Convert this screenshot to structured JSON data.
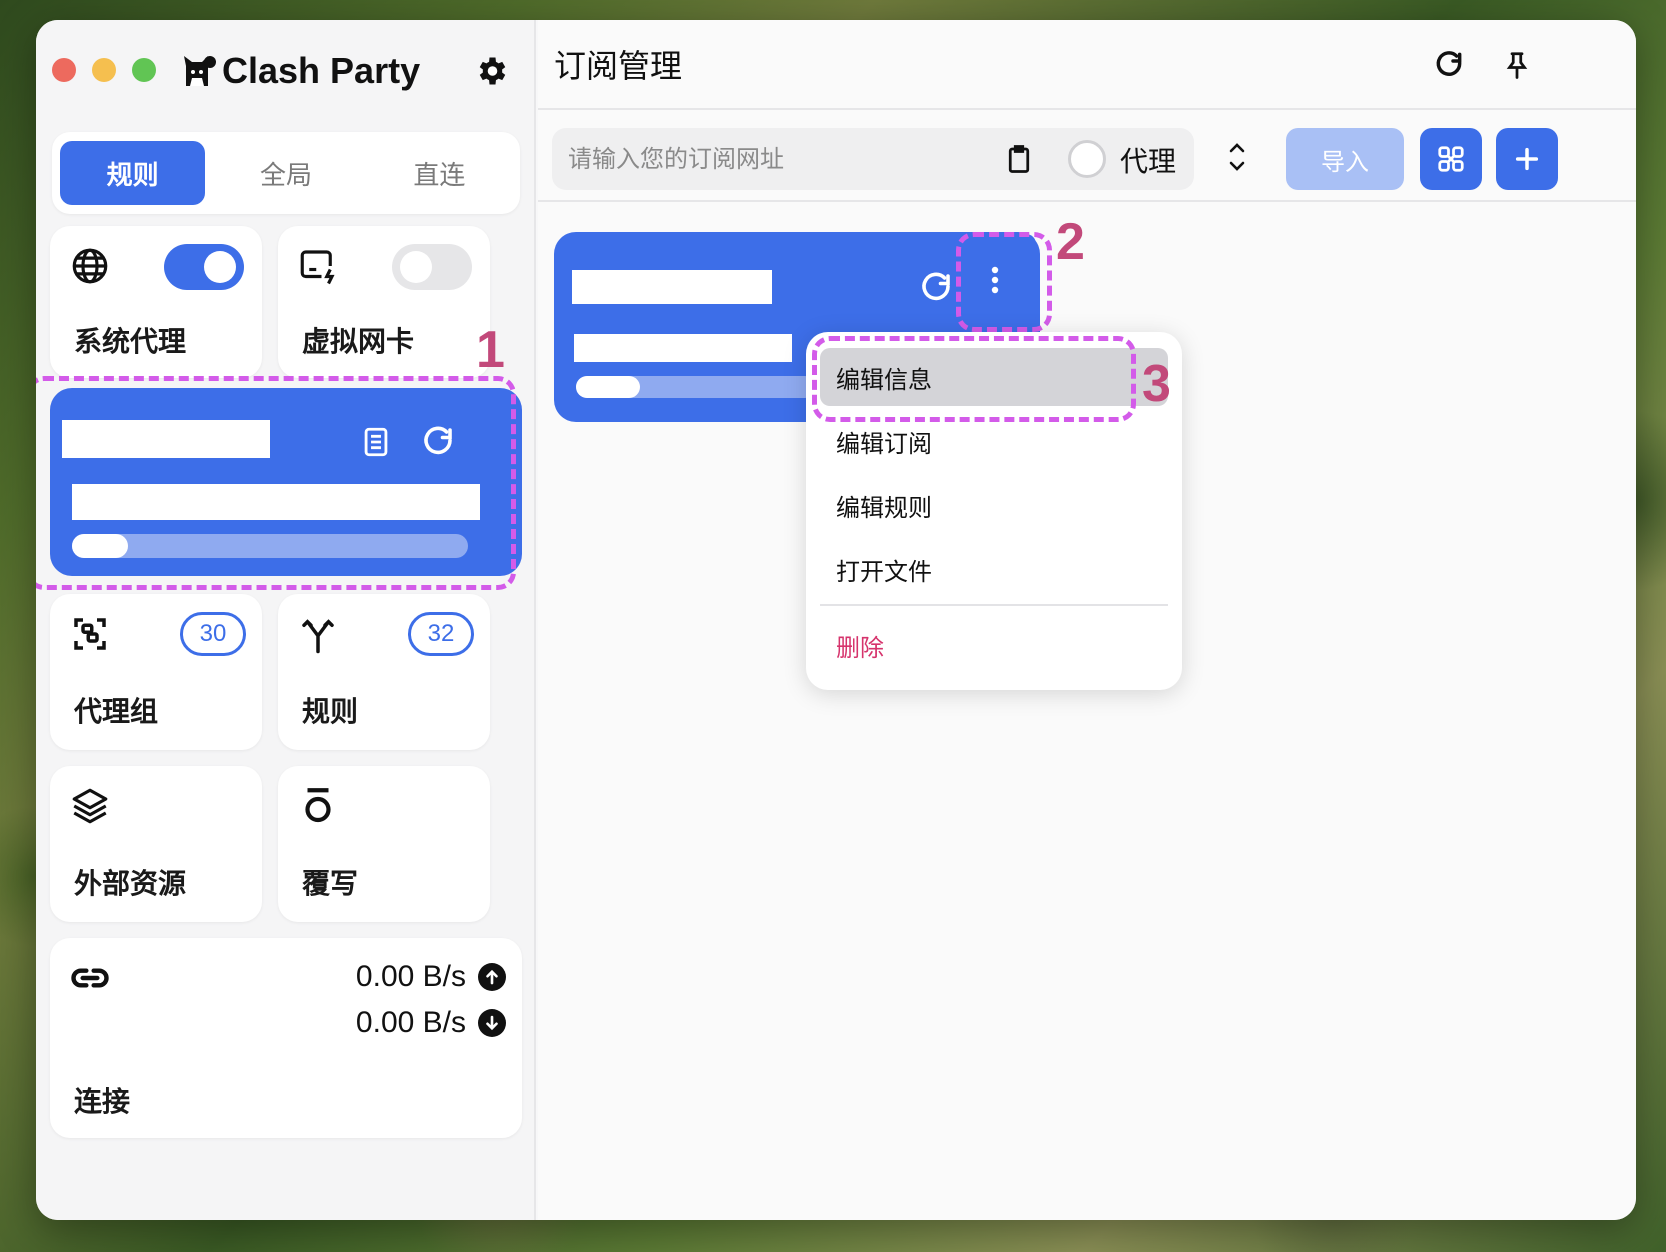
{
  "app": {
    "title": "Clash Party"
  },
  "mode_tabs": [
    {
      "label": "规则",
      "active": true
    },
    {
      "label": "全局",
      "active": false
    },
    {
      "label": "直连",
      "active": false
    }
  ],
  "cards": {
    "system_proxy": {
      "label": "系统代理",
      "enabled": true
    },
    "tun": {
      "label": "虚拟网卡",
      "enabled": false
    },
    "proxy_groups": {
      "label": "代理组",
      "count": "30"
    },
    "rules": {
      "label": "规则",
      "count": "32"
    },
    "external_resources": {
      "label": "外部资源"
    },
    "override": {
      "label": "覆写"
    },
    "connections": {
      "label": "连接",
      "upload": "0.00 B/s",
      "download": "0.00 B/s"
    }
  },
  "main": {
    "title": "订阅管理",
    "url_placeholder": "请输入您的订阅网址",
    "proxy_label": "代理",
    "import_label": "导入"
  },
  "menu": {
    "items": [
      "编辑信息",
      "编辑订阅",
      "编辑规则",
      "打开文件"
    ],
    "delete": "删除"
  },
  "annotations": [
    "1",
    "2",
    "3"
  ],
  "colors": {
    "accent": "#3d6ee8",
    "highlight": "#d35be9",
    "marker": "#c2497a",
    "danger": "#d6336c"
  }
}
